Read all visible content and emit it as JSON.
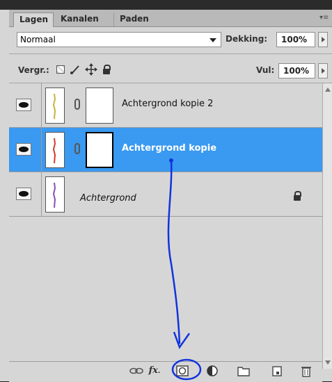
{
  "tabs": [
    "Lagen",
    "Kanalen",
    "Paden"
  ],
  "blend_mode": "Normaal",
  "opacity_label": "Dekking:",
  "opacity_value": "100%",
  "lock_label": "Vergr.:",
  "fill_label": "Vul:",
  "fill_value": "100%",
  "layers": [
    {
      "name": "Achtergrond kopie 2",
      "thumb_color": "#c9b23a"
    },
    {
      "name": "Achtergrond kopie",
      "thumb_color": "#d23a2a"
    },
    {
      "name": "Achtergrond",
      "thumb_color": "#8a4fb0"
    }
  ],
  "toolbar": {
    "fx_label": "fx"
  },
  "colors": {
    "selection": "#3a99f0",
    "annotation": "#1133dd"
  }
}
